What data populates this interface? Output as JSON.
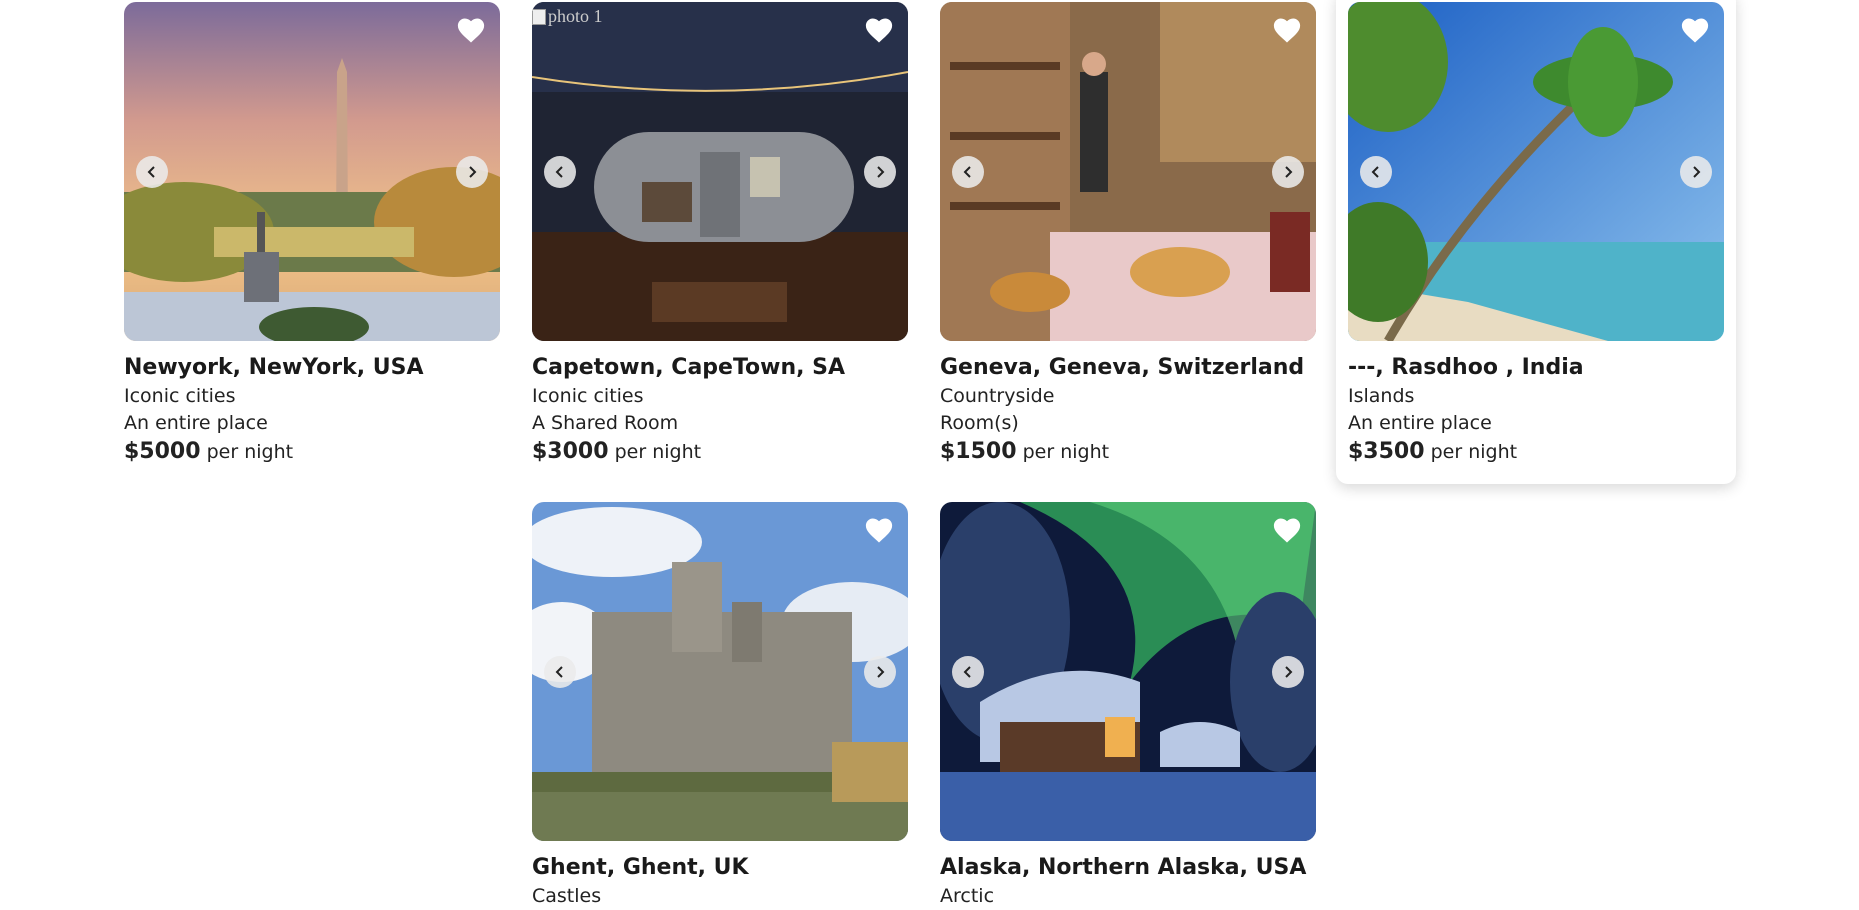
{
  "listings": [
    {
      "title": "Newyork, NewYork, USA",
      "category": "Iconic cities",
      "type": "An entire place",
      "price": "$5000",
      "per": "per night"
    },
    {
      "title": "Capetown, CapeTown, SA",
      "category": "Iconic cities",
      "type": "A Shared Room",
      "price": "$3000",
      "per": "per night",
      "alt": "photo 1"
    },
    {
      "title": "Geneva, Geneva, Switzerland",
      "category": "Countryside",
      "type": "Room(s)",
      "price": "$1500",
      "per": "per night"
    },
    {
      "title": "---, Rasdhoo , India",
      "category": "Islands",
      "type": "An entire place",
      "price": "$3500",
      "per": "per night"
    },
    {
      "title": "Ghent, Ghent, UK",
      "category": "Castles"
    },
    {
      "title": "Alaska, Northern Alaska, USA",
      "category": "Arctic"
    }
  ],
  "icons": {
    "favorite": "heart-icon",
    "prev": "chevron-left-icon",
    "next": "chevron-right-icon"
  }
}
